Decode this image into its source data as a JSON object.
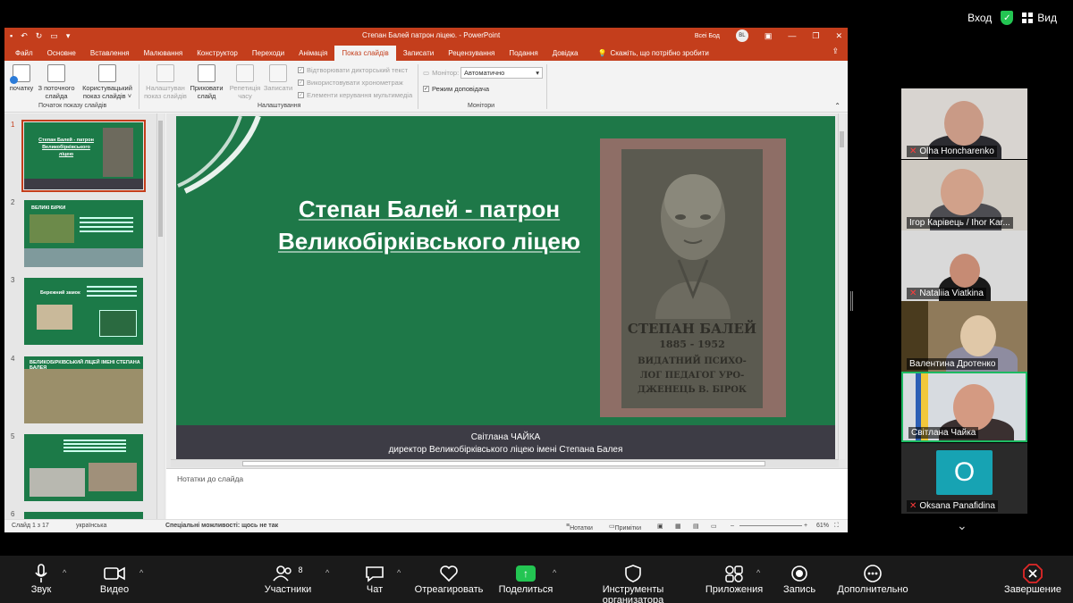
{
  "zoom": {
    "top": {
      "login": "Вход",
      "view": "Вид"
    },
    "toolbar": {
      "audio": "Звук",
      "video": "Видео",
      "participants": "Участники",
      "participants_count": "8",
      "chat": "Чат",
      "react": "Отреагировать",
      "share": "Поделиться",
      "host_tools": "Инструменты организатора",
      "apps": "Приложения",
      "record": "Запись",
      "more": "Дополнительно",
      "end": "Завершение"
    },
    "participants": [
      {
        "name": "Olha Honcharenko",
        "muted": true
      },
      {
        "name": "Ігор Карівець / Ihor Kar...",
        "muted": false
      },
      {
        "name": "Nataliia Viatkina",
        "muted": true
      },
      {
        "name": "Валентина Дротенко",
        "muted": false
      },
      {
        "name": "Світлана Чайка",
        "muted": false
      },
      {
        "name": "Oksana Panafidina",
        "muted": true,
        "initial": "O"
      }
    ]
  },
  "ppt": {
    "doc_title": "Степан Балей патрон ліцею. - PowerPoint",
    "user": "Всеі Бод",
    "user_initials": "BL",
    "tabs": [
      "Файл",
      "Основне",
      "Вставлення",
      "Малювання",
      "Конструктор",
      "Переходи",
      "Анімація",
      "Показ слайдів",
      "Записати",
      "Рецензування",
      "Подання",
      "Довідка"
    ],
    "tell_me": "Скажіть, що потрібно зробити",
    "ribbon": {
      "from_start": "початку",
      "from_current": "З поточного слайда",
      "custom_show": "Користувацький показ слайдів ˅",
      "group_start": "Початок показу слайдів",
      "setup": "Налаштуван показ слайдів",
      "hide": "Приховати слайд",
      "rehearse": "Репетиція часу",
      "record": "Записати",
      "play_narrations": "Відтворювати дикторський текст",
      "use_timings": "Використовувати хронометраж",
      "show_controls": "Елементи керування мультимедіа",
      "group_setup": "Налаштування",
      "monitor_label": "Монітор:",
      "monitor_value": "Автоматично",
      "presenter_view": "Режим доповідача",
      "group_monitors": "Монітори"
    },
    "thumbnails": [
      {
        "num": "1",
        "title": "Степан Балей - патрон Великобірківського ліцею"
      },
      {
        "num": "2",
        "title": "ВЕЛИКІ БІРКИ"
      },
      {
        "num": "3",
        "title": "Бережний замок"
      },
      {
        "num": "4",
        "title": "ВЕЛИКОБІРКІВСЬКИЙ ЛІЦЕЙ ІМЕНІ СТЕПАНА БАЛЕЯ"
      },
      {
        "num": "5",
        "title": ""
      },
      {
        "num": "6",
        "title": ""
      }
    ],
    "slide": {
      "title_line1": "Степан Балей - патрон",
      "title_line2": "Великобірківського ліцею",
      "plaque_name": "СТЕПАН БАЛЕЙ",
      "plaque_years": "1885 - 1952",
      "plaque_line1": "ВИДАТНИЙ ПСИХО-",
      "plaque_line2": "ЛОГ ПЕДАГОГ УРО-",
      "plaque_line3": "ДЖЕНЕЦЬ В. БІРОК",
      "author": "Світлана ЧАЙКА",
      "role": "директор Великобірківського ліцею імені Степана Балея"
    },
    "notes_placeholder": "Нотатки до слайда",
    "status": {
      "slide": "Слайд 1 з 17",
      "lang": "українська",
      "accessibility": "Спеціальні можливості: щось не так",
      "notes": "Нотатки",
      "comments": "Примітки",
      "zoom": "61%"
    }
  }
}
